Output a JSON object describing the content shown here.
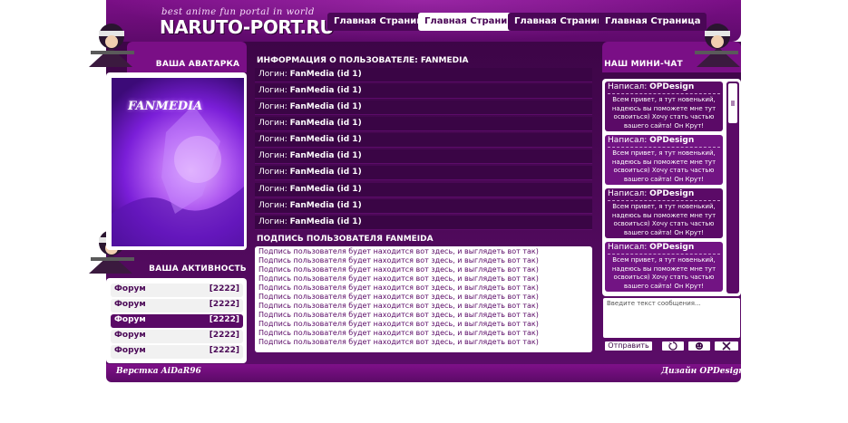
{
  "header": {
    "tagline": "best anime fun portal in world",
    "logo": "NARUTO-PORT.RU",
    "nav": [
      "Главная Страница",
      "Главная Страница",
      "Главная Страница",
      "Главная Страница"
    ]
  },
  "left": {
    "avatar_title": "ВАША АВАТАРКА",
    "avatar_caption": "FANMEDIA",
    "activity_title": "ВАША АКТИВНОСТЬ",
    "activity": [
      {
        "label": "Форум",
        "value": "[2222]"
      },
      {
        "label": "Форум",
        "value": "[2222]"
      },
      {
        "label": "Форум",
        "value": "[2222]"
      },
      {
        "label": "Форум",
        "value": "[2222]"
      },
      {
        "label": "Форум",
        "value": "[2222]"
      }
    ]
  },
  "center": {
    "info_title": "ИНФОРМАЦИЯ О ПОЛЬЗОВАТЕЛЕ: FANMEDIA",
    "login_prefix": "Логин: ",
    "login_value": "FanMedia (id 1)",
    "login_count": 10,
    "sig_title": "ПОДПИСЬ ПОЛЬЗОВАТЕЛЯ FANMEIDA",
    "sig_line": "Подпись пользователя будет находится вот здесь, и выглядеть вот так)"
  },
  "chat": {
    "title": "НАШ МИНИ-ЧАТ",
    "messages": [
      {
        "prefix": "Написал: ",
        "author": "OPDesign",
        "text": "Всем привет, я тут новенький, надеюсь вы поможете мне тут освоиться) Хочу стать частью вашего сайта! Он Крут!"
      },
      {
        "prefix": "Написал: ",
        "author": "OPDesign",
        "text": "Всем привет, я тут новенький, надеюсь вы поможете мне тут освоиться) Хочу стать частью вашего сайта! Он Крут!"
      },
      {
        "prefix": "Написал: ",
        "author": "OPDesign",
        "text": "Всем привет, я тут новенький, надеюсь вы поможете мне тут освоиться) Хочу стать частью вашего сайта! Он Крут!"
      },
      {
        "prefix": "Написал: ",
        "author": "OPDesign",
        "text": "Всем привет, я тут новенький, надеюсь вы поможете мне тут освоиться) Хочу стать частью вашего сайта! Он Крут!"
      }
    ],
    "input_placeholder": "Введите текст сообщения...",
    "send_label": "Отправить",
    "icons": [
      "refresh-icon",
      "smile-icon",
      "tools-icon"
    ]
  },
  "footer": {
    "left": "Верстка AiDaR96",
    "right": "Дизайн OPDesign"
  },
  "colors": {
    "primary": "#5b0a67",
    "dark": "#3a0545",
    "accent": "#7a0f86",
    "active_nav": "#ffffff"
  }
}
